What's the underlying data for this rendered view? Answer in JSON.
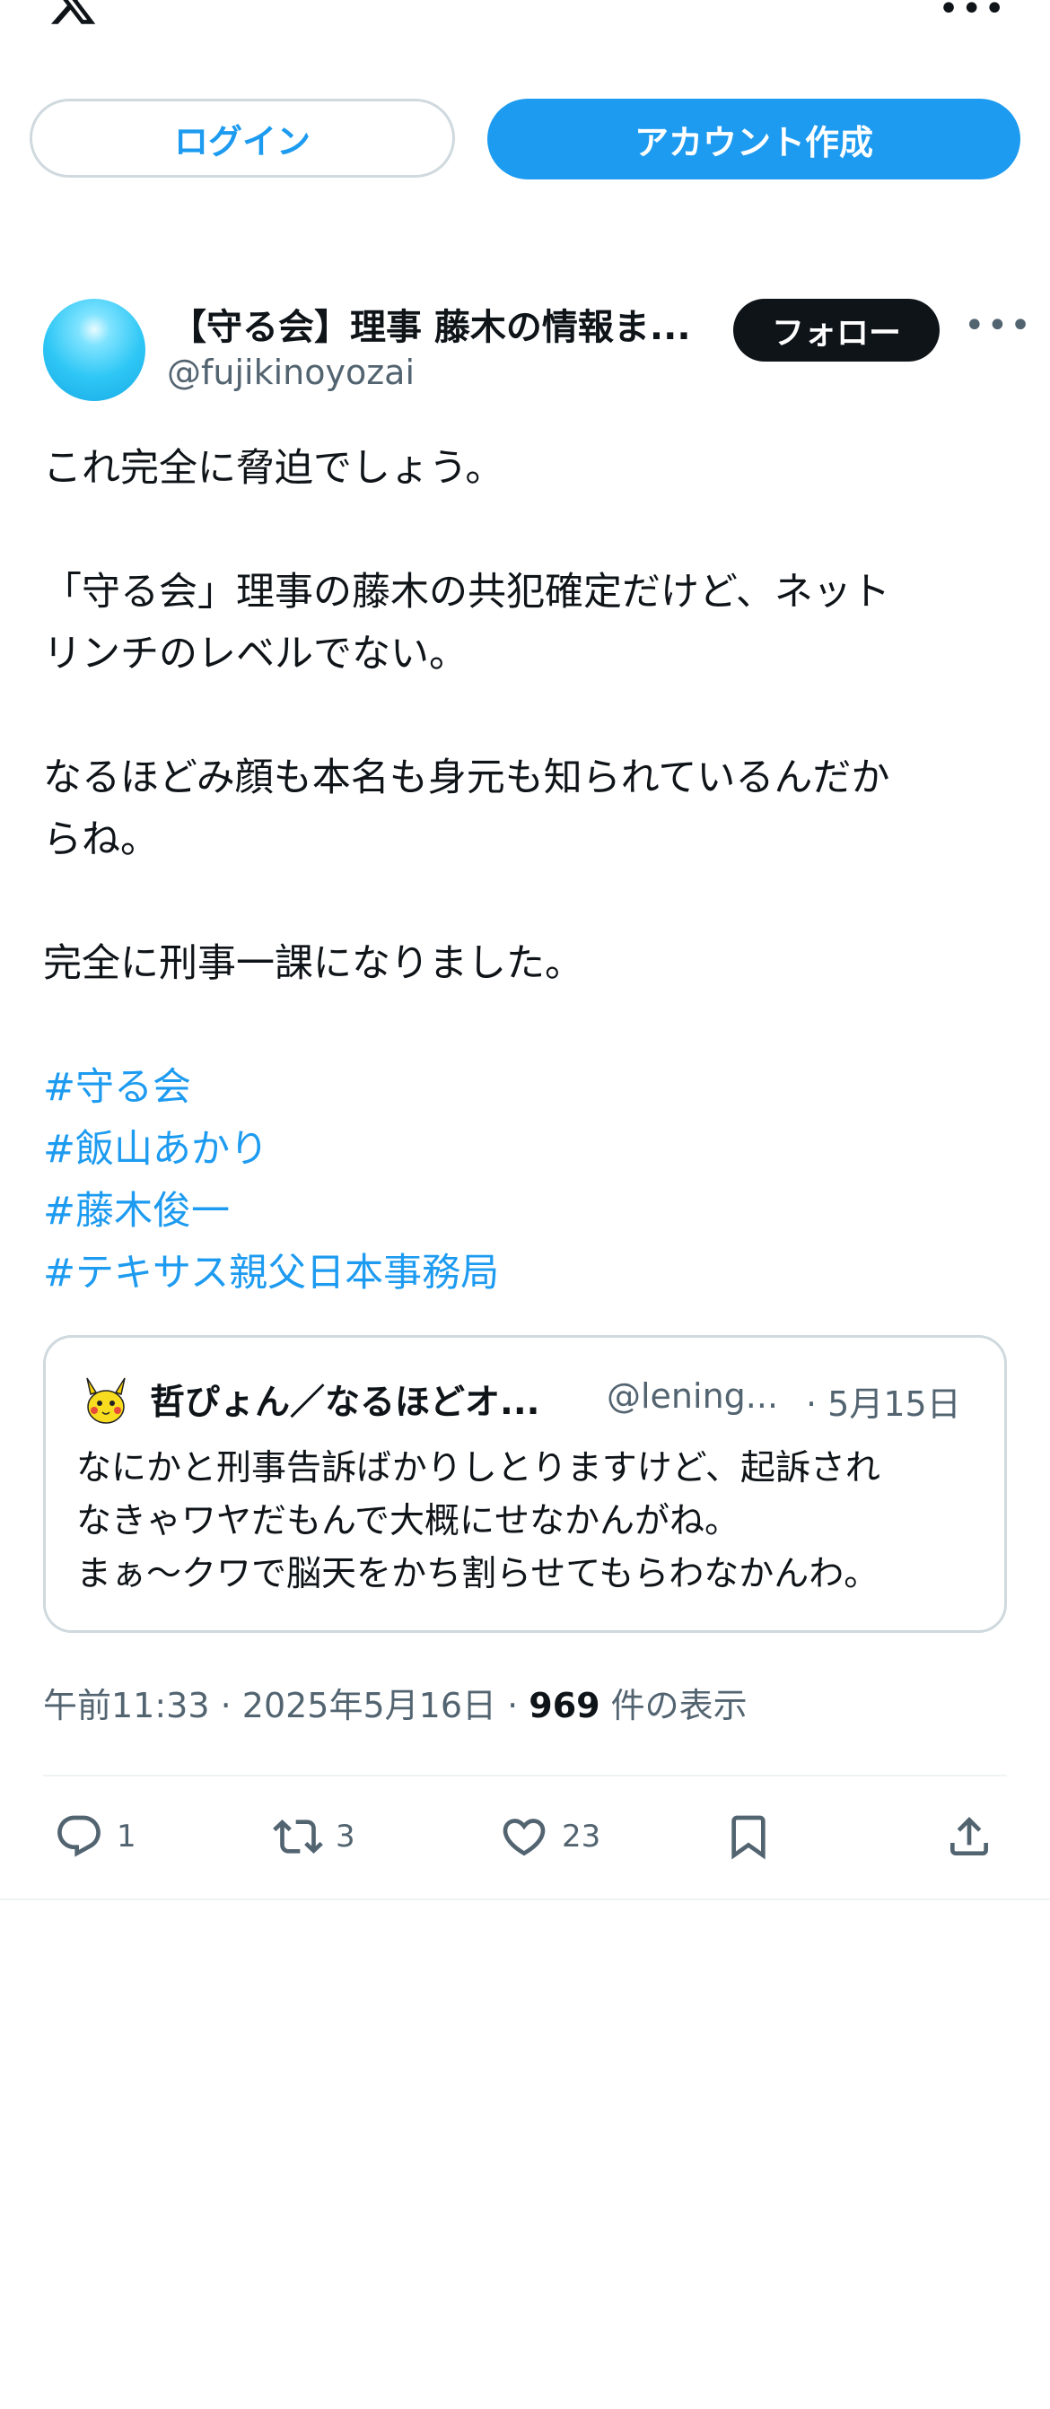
{
  "topbar": {
    "logo": "x-logo-icon",
    "more": "•••"
  },
  "auth": {
    "login_label": "ログイン",
    "signup_label": "アカウント作成"
  },
  "author": {
    "name": "【守る会】理事 藤木の情報ま...",
    "handle": "@fujikinoyozai",
    "follow_label": "フォロー",
    "more": "•••"
  },
  "post": {
    "lines": [
      "これ完全に脅迫でしょう。",
      "「守る会」理事の藤木の共犯確定だけど、ネット",
      "リンチのレベルでない。",
      "なるほどみ顔も本名も身元も知られているんだか",
      "らね。",
      "完全に刑事一課になりました。"
    ],
    "hashtags": [
      "#守る会",
      "#飯山あかり",
      "#藤木俊一",
      "#テキサス親父日本事務局"
    ]
  },
  "quote": {
    "name": "哲ぴょん／なるほどオ...",
    "handle": "@lening...",
    "date": "· 5月15日",
    "lines": [
      "なにかと刑事告訴ばかりしとりますけど、起訴され",
      "なきゃワヤだもんで大概にせなかんがね。",
      "まぁ〜クワで脳天をかち割らせてもらわなかんわ。"
    ]
  },
  "meta": {
    "time": "午前11:33",
    "sep1": " · ",
    "date": "2025年5月16日",
    "sep2": " · ",
    "views": "969",
    "views_label": " 件の表示"
  },
  "actions": {
    "reply_count": "1",
    "retweet_count": "3",
    "like_count": "23"
  },
  "colors": {
    "accent": "#1d9bf0",
    "text": "#0f1419",
    "muted": "#536471",
    "border": "#cfd9de"
  }
}
